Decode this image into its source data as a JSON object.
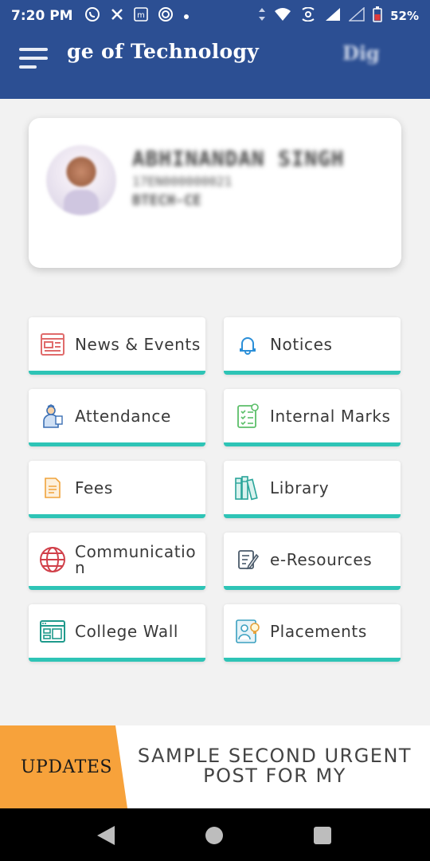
{
  "status_bar": {
    "time": "7:20 PM",
    "battery": "52%",
    "icons": [
      "whatsapp-icon",
      "pinwheel-icon",
      "m-app-icon",
      "swirl-icon",
      "dot-icon",
      "data-arrows-icon",
      "wifi-icon",
      "hotspot-icon",
      "signal-icon",
      "signal-2-icon",
      "battery-icon"
    ]
  },
  "app_bar": {
    "title": "ge of Technology",
    "title_faded": "Dig"
  },
  "profile": {
    "name": "ABHINANDAN SINGH",
    "roll": "17EN000000021",
    "course": "BTECH-CE"
  },
  "tiles": [
    {
      "label": "News & Events",
      "icon": "newspaper-icon",
      "color": "#e06b6b"
    },
    {
      "label": "Notices",
      "icon": "bell-icon",
      "color": "#2b8fd8"
    },
    {
      "label": "Attendance",
      "icon": "teacher-icon",
      "color": "#3b6fb4"
    },
    {
      "label": "Internal Marks",
      "icon": "checklist-icon",
      "color": "#5cbf6a"
    },
    {
      "label": "Fees",
      "icon": "document-icon",
      "color": "#f0a33c"
    },
    {
      "label": "Library",
      "icon": "books-icon",
      "color": "#2aa59a"
    },
    {
      "label": "Communication",
      "icon": "globe-icon",
      "color": "#d1404a"
    },
    {
      "label": "e-Resources",
      "icon": "edit-note-icon",
      "color": "#4a5a6a"
    },
    {
      "label": "College Wall",
      "icon": "dashboard-icon",
      "color": "#1f9a8c"
    },
    {
      "label": "Placements",
      "icon": "person-idea-icon",
      "color": "#3aa0c0"
    }
  ],
  "updates": {
    "badge": "UPDATES",
    "text": "SAMPLE SECOND URGENT POST FOR MY"
  },
  "colors": {
    "primary": "#2c4f93",
    "accent": "#2ec4b6",
    "updates_badge": "#f7a23b"
  }
}
